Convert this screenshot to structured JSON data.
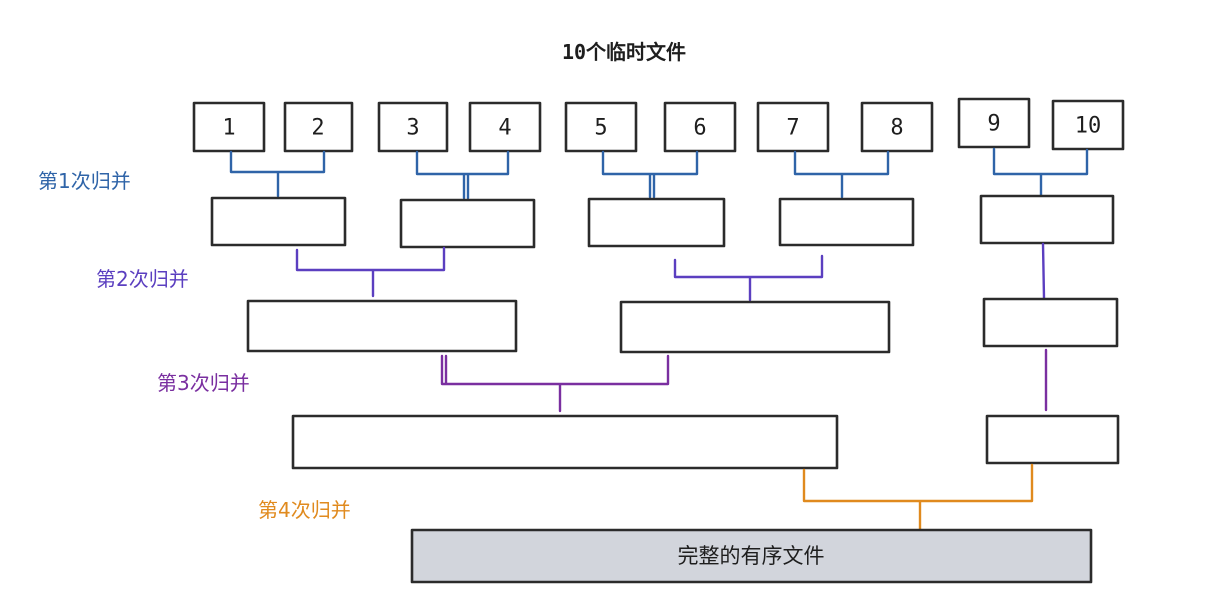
{
  "title": "10个临时文件",
  "files": [
    "1",
    "2",
    "3",
    "4",
    "5",
    "6",
    "7",
    "8",
    "9",
    "10"
  ],
  "merge_rounds": [
    {
      "label": "第1次归并",
      "color": "#2f64a8"
    },
    {
      "label": "第2次归并",
      "color": "#5b3fc0"
    },
    {
      "label": "第3次归并",
      "color": "#7a2fa0"
    },
    {
      "label": "第4次归并",
      "color": "#e08a1e"
    }
  ],
  "final_file": {
    "label": "完整的有序文件",
    "fill": "#d2d5dc"
  }
}
